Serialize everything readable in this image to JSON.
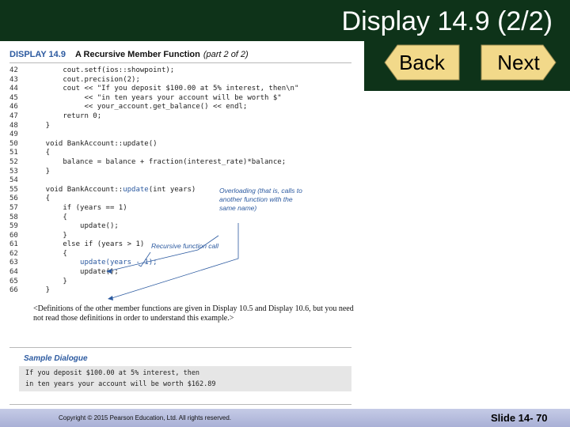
{
  "slide": {
    "title": "Display 14.9 (2/2)",
    "copyright": "Copyright © 2015 Pearson Education, Ltd. All rights reserved.",
    "slide_number": "Slide 14- 70"
  },
  "nav": {
    "back_label": "Back",
    "next_label": "Next"
  },
  "colors": {
    "header_bg": "#0e3319",
    "accent_blue": "#2c5aa0",
    "nav_button": "#f2d98a",
    "footer_bg": "#b3b9dc"
  },
  "display": {
    "label": "DISPLAY 14.9",
    "title": "A Recursive Member Function",
    "part": "(part 2 of 2)"
  },
  "code_lines": [
    {
      "num": "42",
      "pre": "        cout.setf(ios::showpoint);",
      "hl": "",
      "post": ""
    },
    {
      "num": "43",
      "pre": "        cout.precision(2);",
      "hl": "",
      "post": ""
    },
    {
      "num": "44",
      "pre": "        cout << \"If you deposit $100.00 at 5% interest, then\\n\"",
      "hl": "",
      "post": ""
    },
    {
      "num": "45",
      "pre": "             << \"in ten years your account will be worth $\"",
      "hl": "",
      "post": ""
    },
    {
      "num": "46",
      "pre": "             << your_account.get_balance() << endl;",
      "hl": "",
      "post": ""
    },
    {
      "num": "47",
      "pre": "        return 0;",
      "hl": "",
      "post": ""
    },
    {
      "num": "48",
      "pre": "    }",
      "hl": "",
      "post": ""
    },
    {
      "num": "49",
      "pre": "",
      "hl": "",
      "post": ""
    },
    {
      "num": "50",
      "pre": "    void BankAccount::update()",
      "hl": "",
      "post": ""
    },
    {
      "num": "51",
      "pre": "    {",
      "hl": "",
      "post": ""
    },
    {
      "num": "52",
      "pre": "        balance = balance + fraction(interest_rate)*balance;",
      "hl": "",
      "post": ""
    },
    {
      "num": "53",
      "pre": "    }",
      "hl": "",
      "post": ""
    },
    {
      "num": "54",
      "pre": "",
      "hl": "",
      "post": ""
    },
    {
      "num": "55",
      "pre": "    void BankAccount::",
      "hl": "update",
      "post": "(int years)"
    },
    {
      "num": "56",
      "pre": "    {",
      "hl": "",
      "post": ""
    },
    {
      "num": "57",
      "pre": "        if (years == 1)",
      "hl": "",
      "post": ""
    },
    {
      "num": "58",
      "pre": "        {",
      "hl": "",
      "post": ""
    },
    {
      "num": "59",
      "pre": "            update();",
      "hl": "",
      "post": ""
    },
    {
      "num": "60",
      "pre": "        }",
      "hl": "",
      "post": ""
    },
    {
      "num": "61",
      "pre": "        else if (years > 1)",
      "hl": "",
      "post": ""
    },
    {
      "num": "62",
      "pre": "        {",
      "hl": "",
      "post": ""
    },
    {
      "num": "63",
      "pre": "            ",
      "hl": "update(years - 1);",
      "post": ""
    },
    {
      "num": "64",
      "pre": "            update();",
      "hl": "",
      "post": ""
    },
    {
      "num": "65",
      "pre": "        }",
      "hl": "",
      "post": ""
    },
    {
      "num": "66",
      "pre": "    }",
      "hl": "",
      "post": ""
    }
  ],
  "annotations": {
    "overloading": "Overloading (that is, calls to another function with the same name)",
    "recursive": "Recursive function call"
  },
  "note": "<Definitions of the other member functions are given in Display 10.5 and Display 10.6, but you need not read those definitions in order to understand this example.>",
  "sample": {
    "heading": "Sample Dialogue",
    "lines": [
      "If you deposit $100.00 at 5% interest, then",
      "in ten years your account will be worth $162.89"
    ]
  }
}
